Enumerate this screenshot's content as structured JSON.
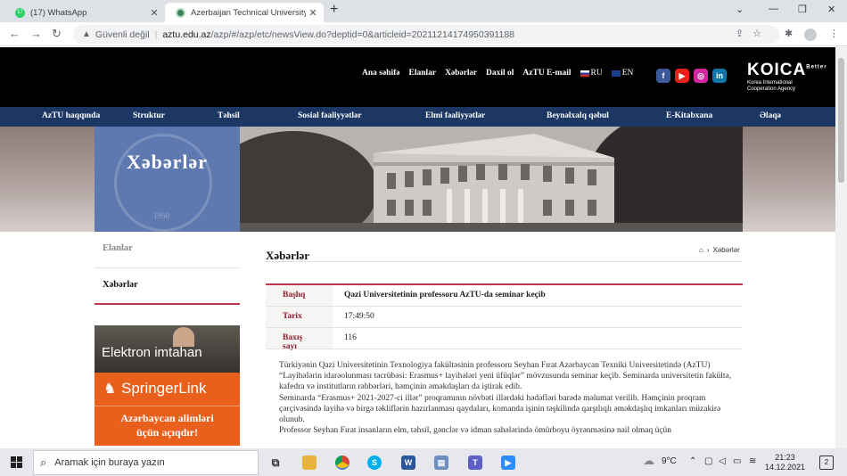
{
  "browser": {
    "tabs": [
      {
        "title": "(17) WhatsApp",
        "badge": "17"
      },
      {
        "title": "Azerbaijan Technical University"
      }
    ],
    "security_label": "Güvenli değil",
    "url_host": "aztu.edu.az",
    "url_path": "/azp/#/azp/etc/newsView.do?deptid=0&articleid=20211214174950391188"
  },
  "site": {
    "top_nav": [
      "Ana səhifə",
      "Elanlar",
      "Xəbərlər",
      "Daxil ol",
      "AzTU E-mail"
    ],
    "lang_ru": "RU",
    "lang_en": "EN",
    "koica_logo": "KOICA",
    "koica_sup": "Better",
    "koica_sub1": "Korea International",
    "koica_sub2": "Cooperation Agency",
    "main_nav": [
      "AzTU haqqında",
      "Struktur",
      "Təhsil",
      "Sosial fəaliyyətlər",
      "Elmi fəaliyyətlər",
      "Beynəlxalq qəbul",
      "E-Kitabxana",
      "Əlaqə"
    ],
    "banner_title": "Xəbərlər",
    "banner_year": "1950"
  },
  "sidebar": {
    "items": [
      "Elanlar",
      "Xəbərlər"
    ],
    "promo1": "Elektron imtahan",
    "promo2": "SpringerLink",
    "promo3_l1": "Azərbaycan alimləri",
    "promo3_l2": "üçün açıqdır!"
  },
  "content": {
    "title": "Xəbərlər",
    "breadcrumb": "Xəbərlər",
    "rows": [
      {
        "label": "Başlıq",
        "value": "Qazi Universitetinin professoru AzTU-da seminar keçib"
      },
      {
        "label": "Tarix",
        "value": "17:49:50"
      },
      {
        "label": "Baxış sayı",
        "value": "116"
      }
    ],
    "paragraph1": "Türkiyənin Qazi Universitetinin Texnologiya fakültəsinin professoru Seyhan Fırat Azərbaycan Texniki Universitetində (AzTU) “Layihələrin idarəolunması təcrübəsi: Erasmus+ layihələri yeni üfüqlər” mövzusunda seminar keçib. Seminarda universitetin fakültə, kafedra və institutların rəhbərləri, həmçinin əməkdaşları da iştirak edib.",
    "paragraph2": "Seminarda “Erasmus+ 2021-2027-ci illər” proqramının növbəti illərdəki hədəfləri barədə məlumat verilib. Həmçinin proqram çərçivəsində layihə və birgə təkliflərin hazırlanması qaydaları,  komanda işinin təşkilində qarşılıqlı əməkdaşlıq imkanları müzakirə olunub.",
    "paragraph3": "Professor Seyhan Fırat insanların elm, təhsil, gənclər və idman sahələrində ömürboyu öyrənməsinə nail olmaq üçün"
  },
  "taskbar": {
    "search_placeholder": "Aramak için buraya yazın",
    "weather": "9°C",
    "time": "21:23",
    "date": "14.12.2021",
    "notifications": "2"
  },
  "colors": {
    "header_bg": "#000000",
    "nav_bg": "#1c3764",
    "accent_red": "#c2364b",
    "label_red": "#8c1c2b",
    "springer_orange": "#e9601d"
  }
}
